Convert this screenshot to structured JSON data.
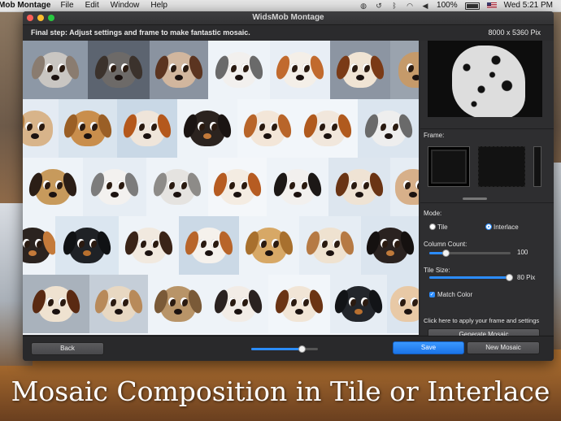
{
  "menubar": {
    "app_name": "Mob Montage",
    "items": [
      "File",
      "Edit",
      "Window",
      "Help"
    ],
    "battery": "100%",
    "clock": "Wed 5:21 PM"
  },
  "window": {
    "title": "WidsMob Montage",
    "step_text": "Final step: Adjust settings and frame to make fantastic mosaic.",
    "output_size": "8000 x 5360 Pix"
  },
  "panel": {
    "frame_label": "Frame:",
    "mode_label": "Mode:",
    "mode_tile": "Tile",
    "mode_interlace": "Interlace",
    "mode_selected": "Interlace",
    "column_count_label": "Column Count:",
    "column_count_value": "100",
    "column_count_level": 0.2,
    "tile_size_label": "Tile Size:",
    "tile_size_value": "80 Pix",
    "tile_size_level": 0.98,
    "match_color_label": "Match Color",
    "match_color_checked": true,
    "apply_hint": "Click here to apply your frame and settings",
    "generate_button": "Generate Mosaic"
  },
  "bottom": {
    "back_button": "Back",
    "zoom_level": 0.75,
    "save_button": "Save",
    "new_mosaic_button": "New Mosaic"
  },
  "caption": "Mosaic Composition in Tile or Interlace",
  "colors": {
    "accent": "#2b8cff",
    "window_bg": "#2b2b2d"
  }
}
